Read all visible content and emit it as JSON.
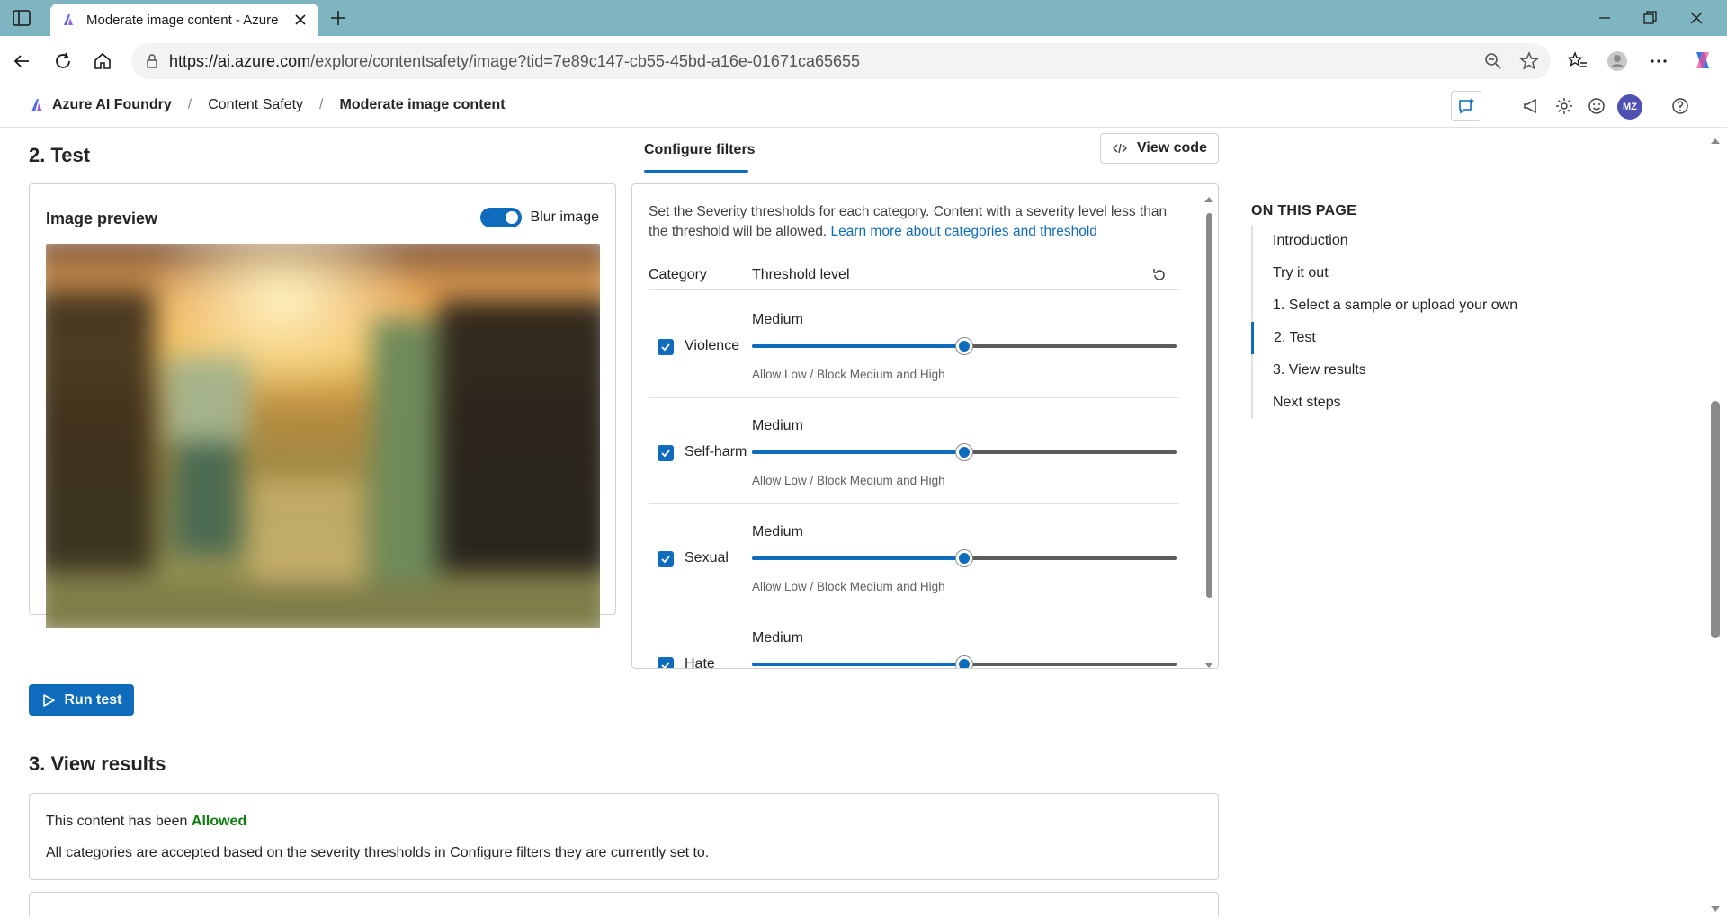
{
  "browser": {
    "tab_title": "Moderate image content - Azure",
    "url_host": "https://ai.azure.com",
    "url_path": "/explore/contentsafety/image?tid=7e89c147-cb55-45bd-a16e-01671ca65655"
  },
  "breadcrumb": {
    "items": [
      "Azure AI Foundry",
      "Content Safety",
      "Moderate image content"
    ],
    "separator": "/"
  },
  "header": {
    "avatar_initials": "MZ"
  },
  "test": {
    "heading": "2. Test",
    "preview_title": "Image preview",
    "blur_label": "Blur image",
    "blur_on": true,
    "run_label": "Run test"
  },
  "filters": {
    "tab_label": "Configure filters",
    "view_code_label": "View code",
    "description": "Set the Severity thresholds for each category. Content with a severity level less than the threshold will be allowed. ",
    "learn_more": "Learn more about categories and threshold",
    "col_category": "Category",
    "col_threshold": "Threshold level",
    "rows": [
      {
        "category": "Violence",
        "level": "Medium",
        "note": "Allow Low / Block Medium and High",
        "value": 0.5,
        "checked": true
      },
      {
        "category": "Self-harm",
        "level": "Medium",
        "note": "Allow Low / Block Medium and High",
        "value": 0.5,
        "checked": true
      },
      {
        "category": "Sexual",
        "level": "Medium",
        "note": "Allow Low / Block Medium and High",
        "value": 0.5,
        "checked": true
      },
      {
        "category": "Hate",
        "level": "Medium",
        "note": "",
        "value": 0.5,
        "checked": true
      }
    ]
  },
  "results": {
    "heading": "3. View results",
    "line1_prefix": "This content has been ",
    "status": "Allowed",
    "line2": "All categories are accepted based on the severity thresholds in Configure filters they are currently set to."
  },
  "toc": {
    "title": "ON THIS PAGE",
    "items": [
      "Introduction",
      "Try it out",
      "1. Select a sample or upload your own",
      "2. Test",
      "3. View results",
      "Next steps"
    ],
    "active_index": 3
  },
  "colors": {
    "accent": "#0f6cbd",
    "allowed": "#107c10",
    "chrome": "#7fb5c1"
  }
}
